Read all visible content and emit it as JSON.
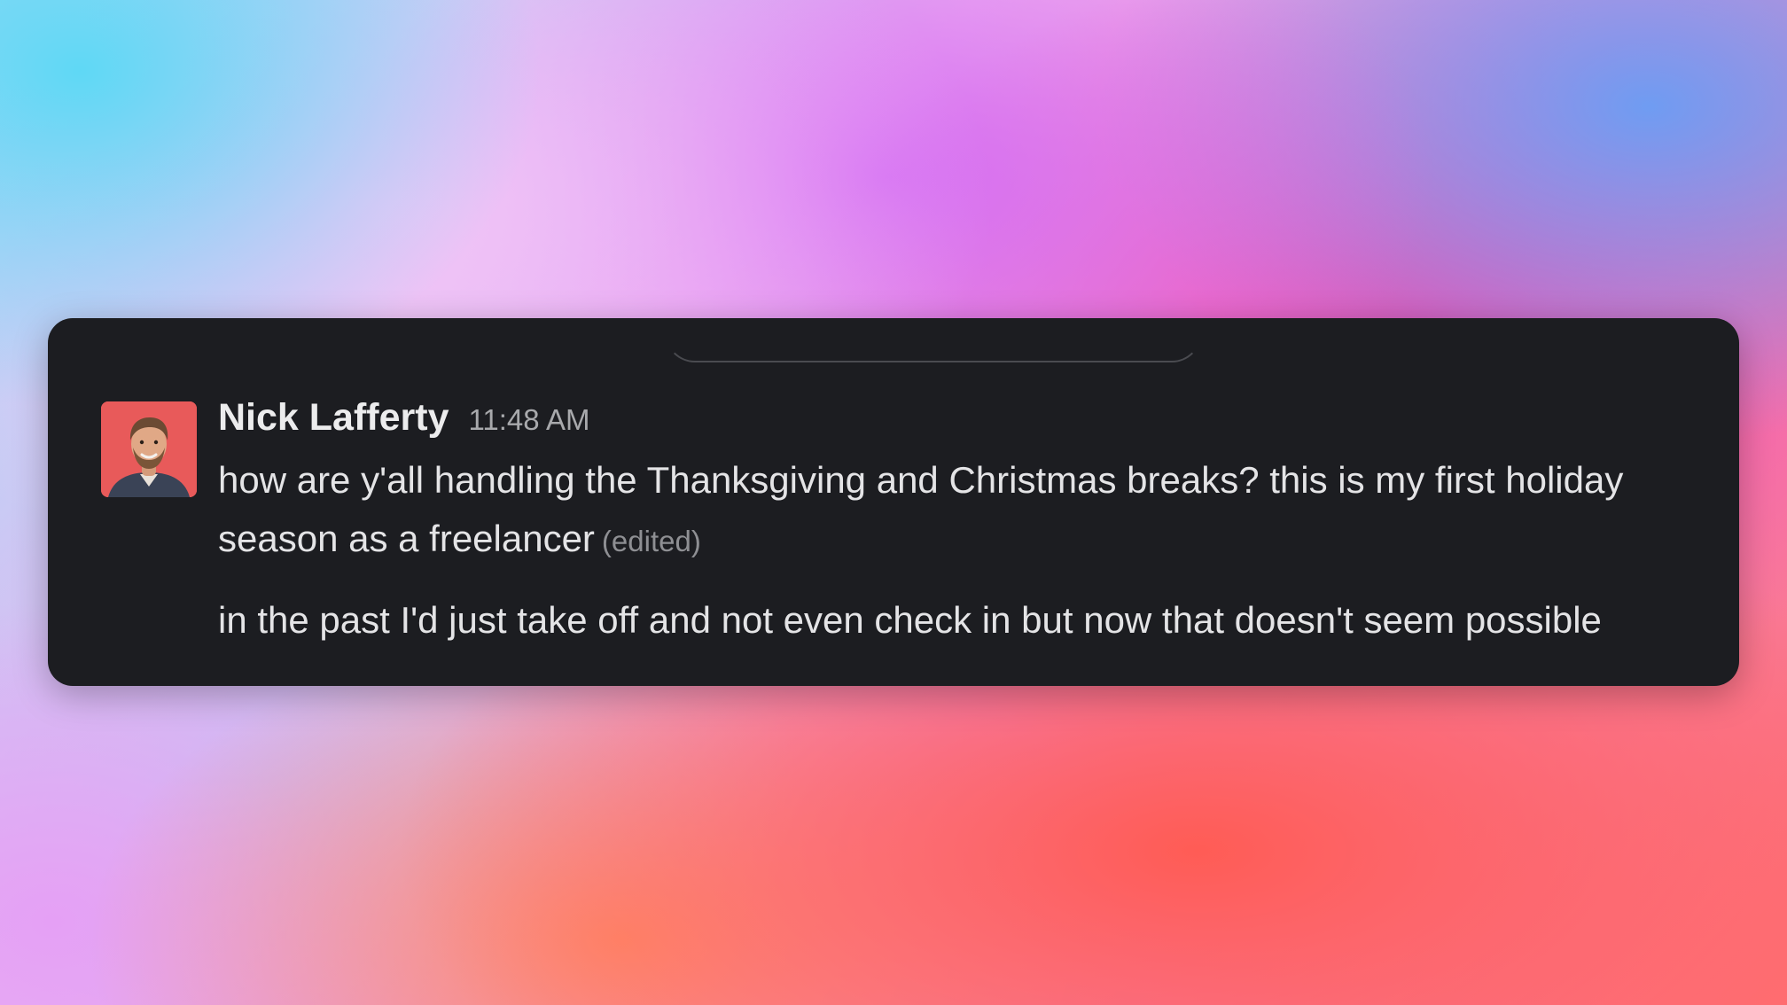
{
  "message": {
    "author": "Nick Lafferty",
    "timestamp": "11:48 AM",
    "paragraphs": [
      "how are y'all handling the Thanksgiving and Christmas breaks? this is my first holiday season as a freelancer",
      "in the past I'd just take off and not even check in but now that doesn't seem possible"
    ],
    "edited_label": "(edited)"
  },
  "colors": {
    "card_background": "#1c1d21",
    "avatar_background": "#e85a5a",
    "author_text": "#ececed",
    "body_text": "#e4e4e6",
    "muted_text": "#a8a9ac"
  },
  "icons": {
    "avatar": "user-photo"
  }
}
